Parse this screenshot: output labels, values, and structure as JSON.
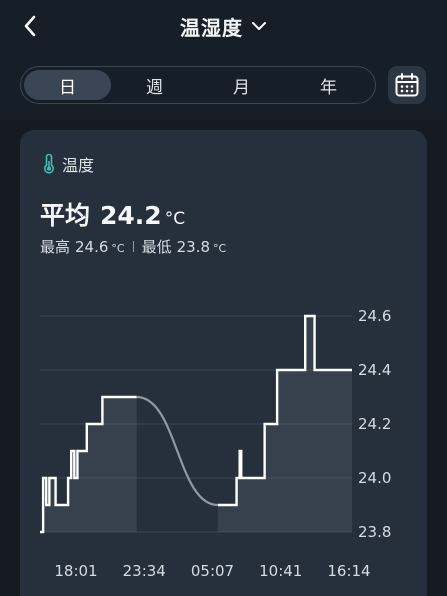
{
  "header": {
    "title": "温湿度",
    "back_icon": "chevron-left-icon",
    "dropdown_icon": "chevron-down-icon"
  },
  "tabs": [
    {
      "label": "日",
      "active": true
    },
    {
      "label": "週",
      "active": false
    },
    {
      "label": "月",
      "active": false
    },
    {
      "label": "年",
      "active": false
    }
  ],
  "calendar_icon": "calendar-icon",
  "card": {
    "sensor_icon": "thermometer-icon",
    "sensor_label": "温度",
    "avg_label": "平均",
    "avg_value": "24.2",
    "avg_unit": "°C",
    "max_label": "最高",
    "max_value": "24.6",
    "min_label": "最低",
    "min_value": "23.8",
    "unit": "°C"
  },
  "colors": {
    "background": "#141b23",
    "card": "#25303c",
    "accent": "#3fc1b4",
    "line": "#ffffff",
    "interpolated_line": "#8f99a3"
  },
  "chart_data": {
    "type": "line",
    "title": "",
    "xlabel": "",
    "ylabel": "",
    "x_ticks": [
      "18:01",
      "23:34",
      "05:07",
      "10:41",
      "16:14"
    ],
    "y_ticks": [
      23.8,
      24.0,
      24.2,
      24.4,
      24.6
    ],
    "ylim": [
      23.8,
      24.6
    ],
    "xlim": [
      0,
      100
    ],
    "grid": true,
    "y_axis_side": "right",
    "series": [
      {
        "style": "step",
        "points": [
          [
            0,
            23.8
          ],
          [
            1,
            23.8
          ],
          [
            1,
            24.0
          ],
          [
            2,
            24.0
          ],
          [
            2,
            23.9
          ],
          [
            3,
            23.9
          ],
          [
            3,
            24.0
          ],
          [
            5,
            24.0
          ],
          [
            5,
            23.9
          ],
          [
            9,
            23.9
          ],
          [
            9,
            24.0
          ],
          [
            10,
            24.0
          ],
          [
            10,
            24.1
          ],
          [
            11,
            24.1
          ],
          [
            11,
            24.0
          ],
          [
            12,
            24.0
          ],
          [
            12,
            24.1
          ],
          [
            15,
            24.1
          ],
          [
            15,
            24.2
          ],
          [
            20,
            24.2
          ],
          [
            20,
            24.3
          ],
          [
            31,
            24.3
          ]
        ]
      },
      {
        "style": "interpolated",
        "points": [
          [
            31,
            24.3
          ],
          [
            57,
            23.9
          ]
        ]
      },
      {
        "style": "step",
        "points": [
          [
            57,
            23.9
          ],
          [
            63,
            23.9
          ],
          [
            63,
            24.0
          ],
          [
            64,
            24.0
          ],
          [
            64,
            24.1
          ],
          [
            64.5,
            24.1
          ],
          [
            64.5,
            24.0
          ],
          [
            72,
            24.0
          ],
          [
            72,
            24.2
          ],
          [
            76,
            24.2
          ],
          [
            76,
            24.4
          ],
          [
            85,
            24.4
          ],
          [
            85,
            24.6
          ],
          [
            88,
            24.6
          ],
          [
            88,
            24.4
          ],
          [
            100,
            24.4
          ]
        ]
      }
    ]
  }
}
